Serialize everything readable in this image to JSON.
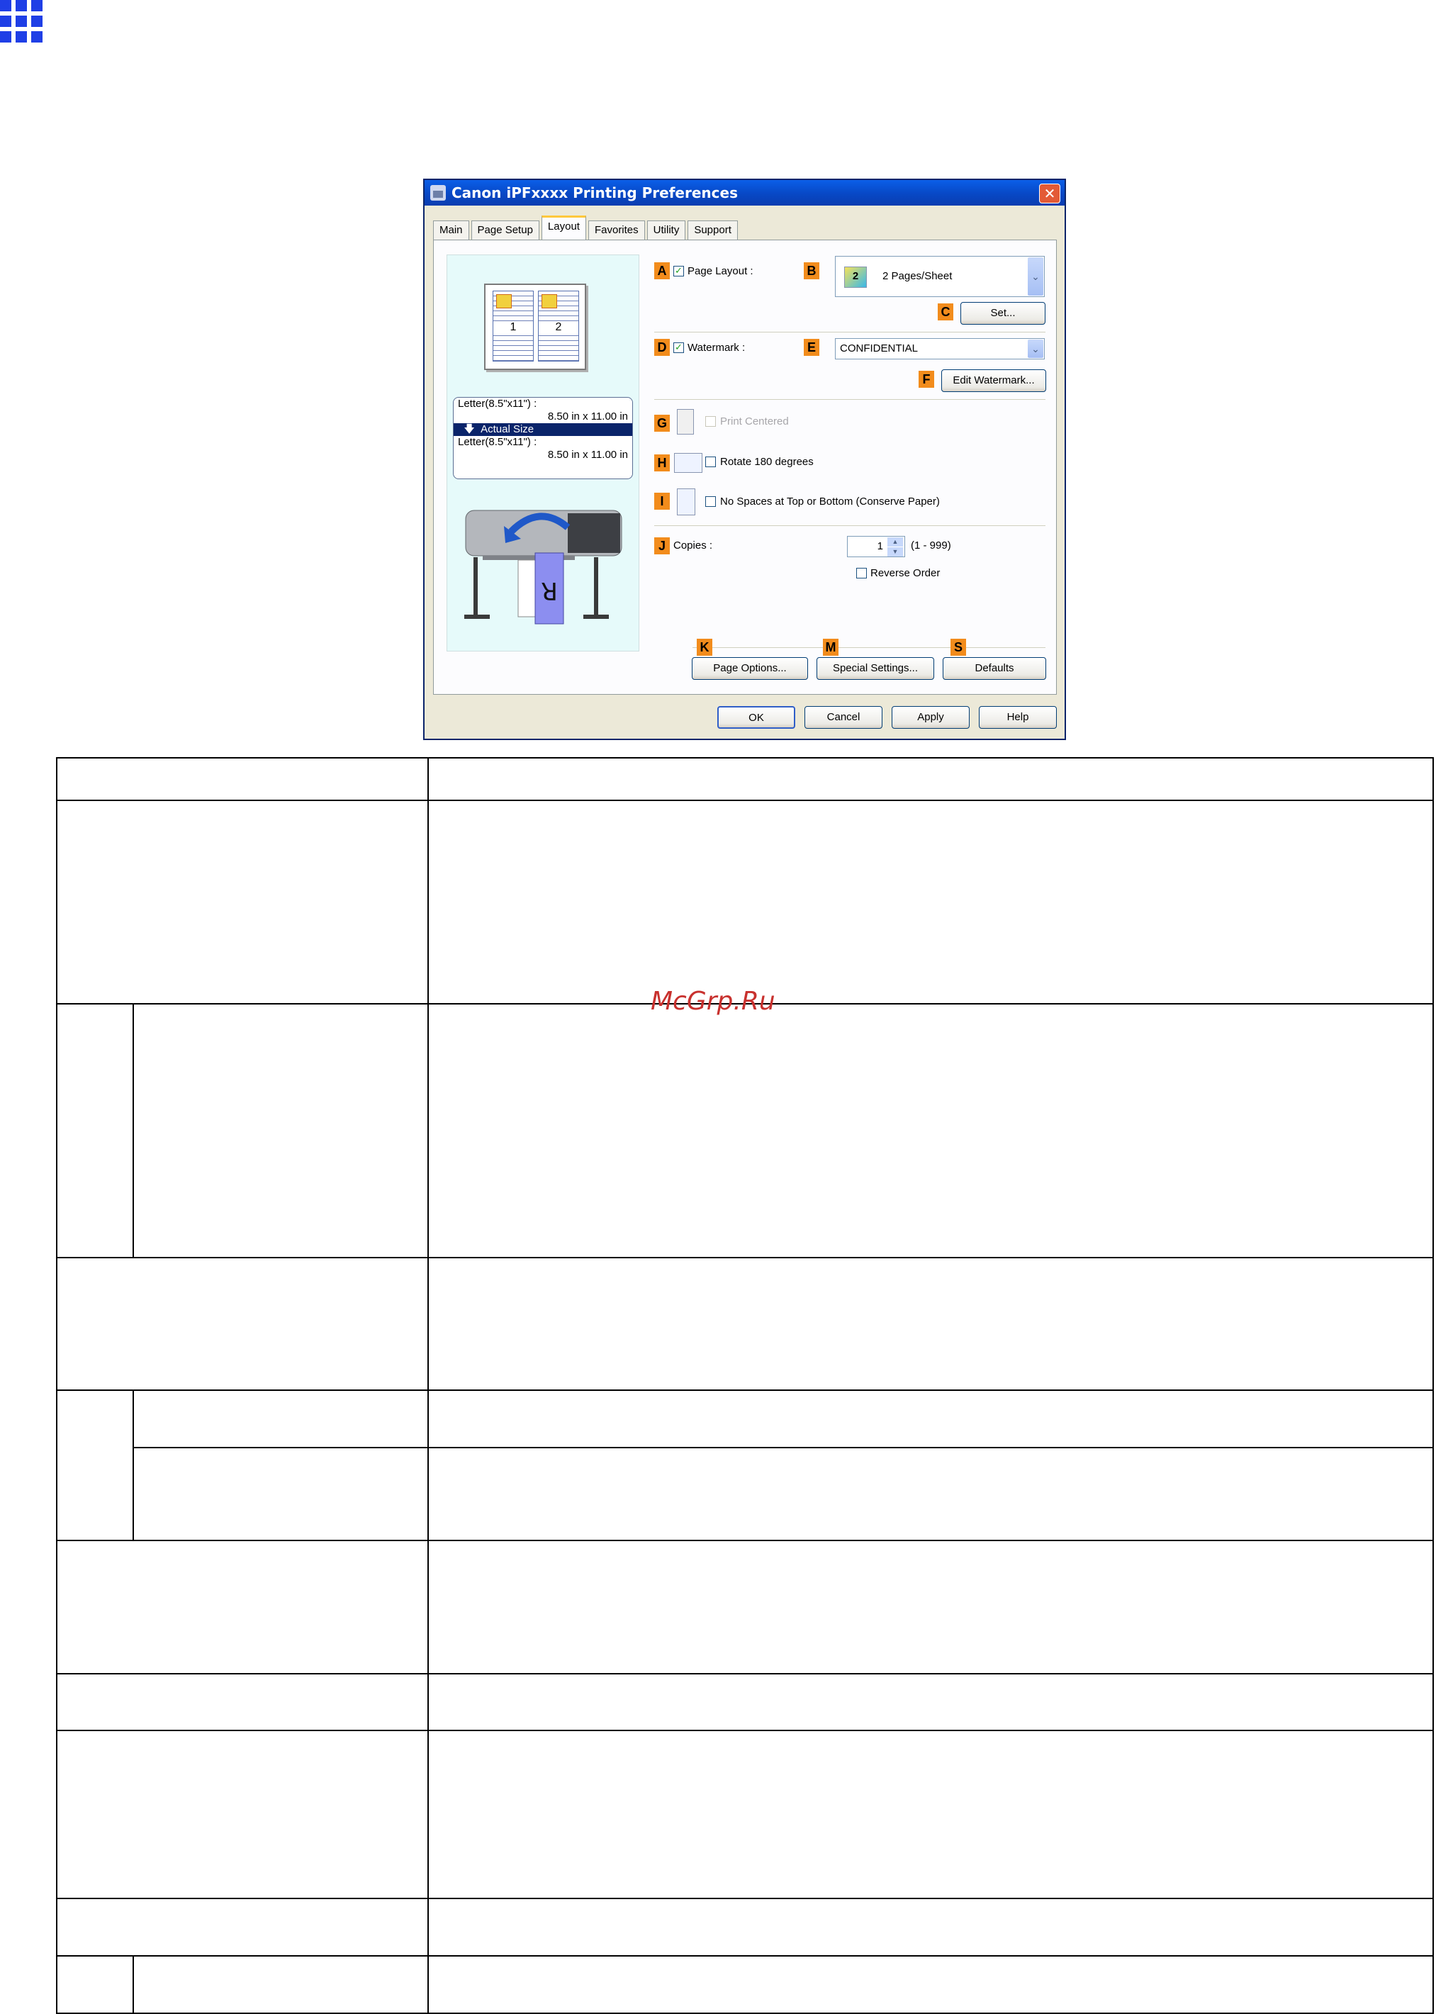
{
  "dialog": {
    "title": "Canon iPFxxxx Printing Preferences",
    "close_glyph": "✕",
    "tabs": [
      {
        "label": "Main",
        "active": false
      },
      {
        "label": "Page Setup",
        "active": false
      },
      {
        "label": "Layout",
        "active": true
      },
      {
        "label": "Favorites",
        "active": false
      },
      {
        "label": "Utility",
        "active": false
      },
      {
        "label": "Support",
        "active": false
      }
    ],
    "preview": {
      "page_numbers": [
        "1",
        "2"
      ],
      "size_lines": [
        "Letter(8.5\"x11\") :",
        "8.50 in x 11.00 in",
        "Actual Size",
        "Letter(8.5\"x11\") :",
        "8.50 in x 11.00 in"
      ],
      "printer_letter": "R"
    },
    "labels": {
      "A": "A",
      "B": "B",
      "C": "C",
      "D": "D",
      "E": "E",
      "F": "F",
      "G": "G",
      "H": "H",
      "I": "I",
      "J": "J",
      "K": "K",
      "M": "M",
      "S": "S"
    },
    "page_layout": {
      "label": "Page Layout :",
      "checked": true,
      "value": "2 Pages/Sheet",
      "icon_number": "2"
    },
    "set_button": "Set...",
    "watermark": {
      "label": "Watermark :",
      "checked": true,
      "value": "CONFIDENTIAL"
    },
    "edit_watermark_button": "Edit Watermark...",
    "print_centered": {
      "label": "Print Centered",
      "checked": false,
      "disabled": true
    },
    "rotate": {
      "label": "Rotate 180 degrees",
      "checked": false
    },
    "no_spaces": {
      "label": "No Spaces at Top or Bottom (Conserve Paper)",
      "checked": false
    },
    "copies": {
      "label": "Copies :",
      "value": "1",
      "range": "(1 - 999)"
    },
    "reverse_order": {
      "label": "Reverse Order",
      "checked": false
    },
    "page_options_button": "Page Options...",
    "special_settings_button": "Special Settings...",
    "defaults_button": "Defaults",
    "footer": {
      "ok": "OK",
      "cancel": "Cancel",
      "apply": "Apply",
      "help": "Help"
    },
    "check_glyph": "✓",
    "arrow_glyph": "⌄",
    "spin_up": "▲",
    "spin_down": "▼"
  },
  "watermark_text": "McGrp.Ru",
  "accent_colors": {
    "title_bar": "#0a5ee8",
    "label_tag": "#f28c1c",
    "grid_icon": "#1f3fe6",
    "watermark": "#c8312e"
  }
}
